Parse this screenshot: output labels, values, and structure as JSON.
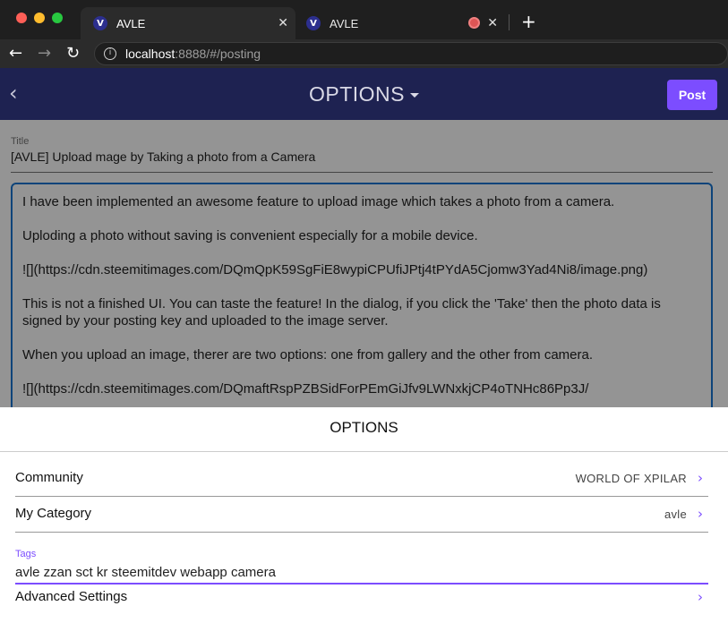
{
  "browser": {
    "tabs": [
      {
        "title": "AVLE",
        "active": true,
        "close": "✕"
      },
      {
        "title": "AVLE",
        "active": false,
        "close": "✕",
        "recording": true
      }
    ],
    "new_tab": "+",
    "url_host": "localhost",
    "url_path": ":8888/#/posting",
    "favicon_letter": "V"
  },
  "appbar": {
    "title": "OPTIONS",
    "post_label": "Post",
    "color": "#1e2251",
    "accent": "#7c4dff"
  },
  "editor": {
    "title_label": "Title",
    "title_value": "[AVLE] Upload mage by Taking a photo from a Camera",
    "body_paragraphs": [
      "I have been implemented an awesome feature to upload image which takes a photo from a camera.",
      "Uploding a photo without saving is convenient especially for a mobile device.",
      "![](https://cdn.steemitimages.com/DQmQpK59SgFiE8wypiCPUfiJPtj4tPYdA5Cjomw3Yad4Ni8/image.png)",
      "This is not a finished UI. You can taste the feature! In the dialog, if you click the 'Take' then the photo data is signed by your posting key and uploaded to the image server.",
      "When you upload an image, therer are two options: one from gallery and the other from camera.",
      "![](https://cdn.steemitimages.com/DQmaftRspPZBSidForPEmGiJfv9LWNxkjCP4oTNHc86Pp3J/"
    ]
  },
  "options_sheet": {
    "title": "OPTIONS",
    "community_label": "Community",
    "community_value": "WORLD OF XPILAR",
    "category_label": "My Category",
    "category_value": "avle",
    "tags_label": "Tags",
    "tags_value": "avle zzan sct kr steemitdev webapp camera",
    "advanced_label": "Advanced Settings"
  }
}
